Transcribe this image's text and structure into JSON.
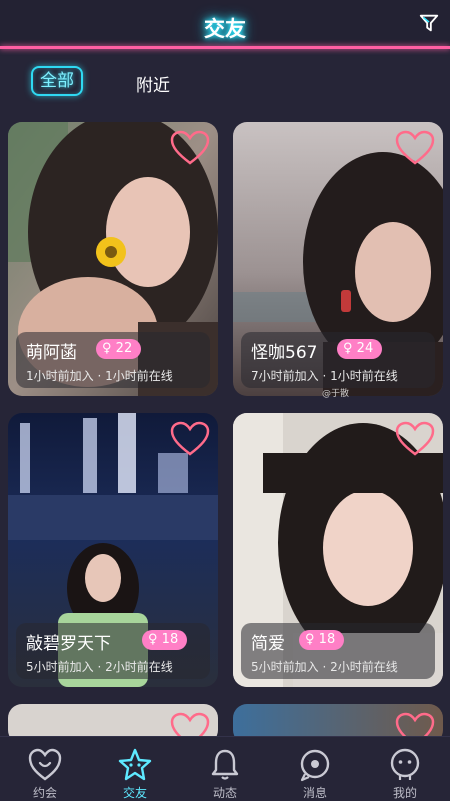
{
  "header": {
    "title": "交友",
    "filter_icon": "filter-icon"
  },
  "tabs": {
    "all_label": "全部",
    "nearby_label": "附近",
    "active": "全部"
  },
  "colors": {
    "accent_cyan": "#2ee8ff",
    "accent_pink": "#ff5fa3",
    "badge_pink": "#ff7fc6",
    "background": "#262537"
  },
  "cards": [
    {
      "name": "萌阿菡",
      "gender_symbol": "♀",
      "age": "22",
      "status": "1小时前加入 · 1小时前在线",
      "favorited": false
    },
    {
      "name": "怪咖567",
      "gender_symbol": "♀",
      "age": "24",
      "status": "7小时前加入 · 1小时前在线",
      "favorited": false
    },
    {
      "name": "敲碧罗天下",
      "gender_symbol": "♀",
      "age": "18",
      "status": "5小时前加入 · 2小时前在线",
      "favorited": false
    },
    {
      "name": "简爱",
      "gender_symbol": "♀",
      "age": "18",
      "status": "5小时前加入 · 2小时前在线",
      "favorited": false
    }
  ],
  "watermark": "@于散",
  "bottom_nav": [
    {
      "label": "约会",
      "icon": "heart-icon"
    },
    {
      "label": "交友",
      "icon": "star-icon"
    },
    {
      "label": "动态",
      "icon": "bell-icon"
    },
    {
      "label": "消息",
      "icon": "message-icon"
    },
    {
      "label": "我的",
      "icon": "profile-icon"
    }
  ],
  "active_nav": "交友"
}
